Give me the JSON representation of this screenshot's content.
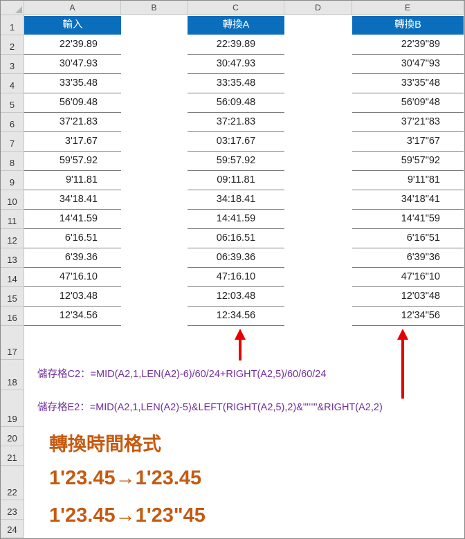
{
  "columns": [
    "A",
    "B",
    "C",
    "D",
    "E"
  ],
  "rows": [
    "1",
    "2",
    "3",
    "4",
    "5",
    "6",
    "7",
    "8",
    "9",
    "10",
    "11",
    "12",
    "13",
    "14",
    "15",
    "16",
    "17",
    "18",
    "19",
    "20",
    "21",
    "22",
    "23",
    "24"
  ],
  "headers": {
    "a": "輸入",
    "c": "轉換A",
    "e": "轉換B"
  },
  "col_a": [
    "22'39.89",
    "30'47.93",
    "33'35.48",
    "56'09.48",
    "37'21.83",
    "3'17.67",
    "59'57.92",
    "9'11.81",
    "34'18.41",
    "14'41.59",
    "6'16.51",
    "6'39.36",
    "47'16.10",
    "12'03.48",
    "12'34.56"
  ],
  "col_c": [
    "22:39.89",
    "30:47.93",
    "33:35.48",
    "56:09.48",
    "37:21.83",
    "03:17.67",
    "59:57.92",
    "09:11.81",
    "34:18.41",
    "14:41.59",
    "06:16.51",
    "06:39.36",
    "47:16.10",
    "12:03.48",
    "12:34.56"
  ],
  "col_e": [
    "22'39\"89",
    "30'47\"93",
    "33'35\"48",
    "56'09\"48",
    "37'21\"83",
    "3'17\"67",
    "59'57\"92",
    "9'11\"81",
    "34'18\"41",
    "14'41\"59",
    "6'16\"51",
    "6'39\"36",
    "47'16\"10",
    "12'03\"48",
    "12'34\"56"
  ],
  "formula_c2": "儲存格C2：=MID(A2,1,LEN(A2)-6)/60/24+RIGHT(A2,5)/60/60/24",
  "formula_e2": "儲存格E2：=MID(A2,1,LEN(A2)-5)&LEFT(RIGHT(A2,5),2)&\"\"\"\"&RIGHT(A2,2)",
  "title": "轉換時間格式",
  "example1": "1'23.45→1'23.45",
  "example2": "1'23.45→1'23\"45",
  "colors": {
    "header_fill": "#0a6ebd",
    "formula_text": "#7030a0",
    "title_text": "#c55a11",
    "arrow": "#e60000"
  }
}
